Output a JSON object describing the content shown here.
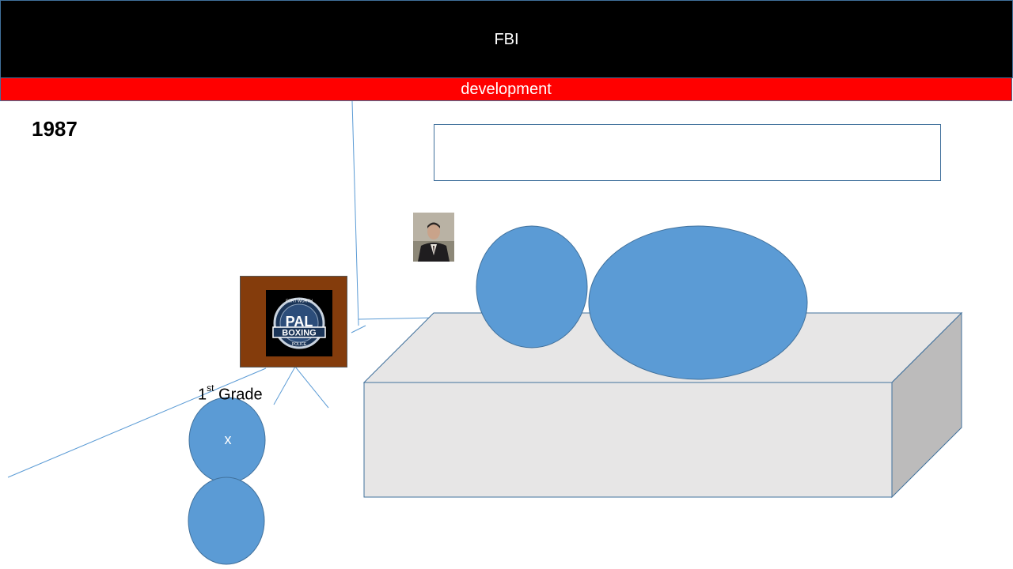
{
  "header": {
    "title": "FBI"
  },
  "band": {
    "label": "development"
  },
  "year": "1987",
  "grade": {
    "number": "1",
    "suffix": "st",
    "word": "Grade"
  },
  "circle_mark": "x",
  "logo": {
    "top_text": "FORT WORTH",
    "main": "PAL",
    "sub": "BOXING",
    "bottom_text": "POLICE"
  },
  "colors": {
    "header_bg": "#000000",
    "band_bg": "#ff0000",
    "shape_fill": "#5b9bd5",
    "shape_stroke": "#41719c",
    "box_face": "#e7e6e6",
    "box_side": "#bcbbbb",
    "frame": "#843c0c"
  }
}
